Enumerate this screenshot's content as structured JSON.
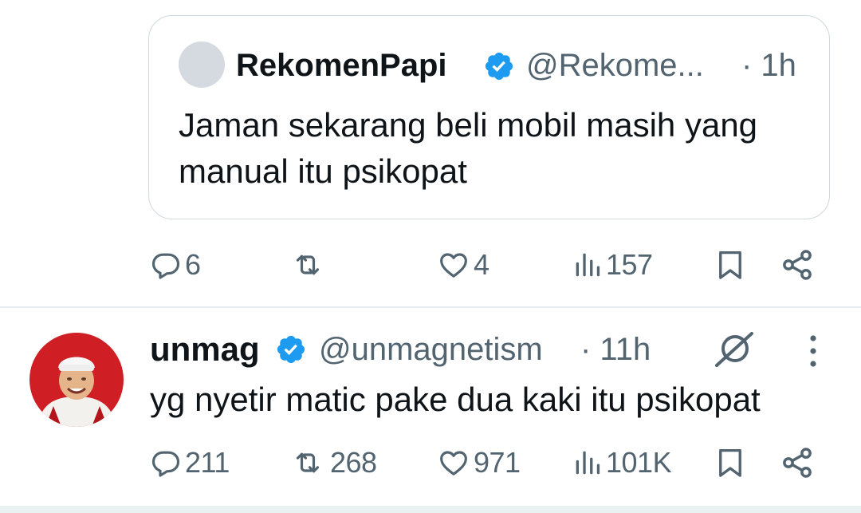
{
  "quote": {
    "name": "RekomenPapi",
    "handle": "@Rekome...",
    "time": "· 1h",
    "text": "Jaman sekarang beli mobil masih yang manual itu psikopat"
  },
  "quote_actions": {
    "replies": "6",
    "likes": "4",
    "views": "157"
  },
  "reply": {
    "name": "unmag",
    "handle": "@unmagnetism",
    "time": "· 11h",
    "text": "yg nyetir matic pake dua kaki itu psikopat"
  },
  "reply_actions": {
    "replies": "211",
    "reposts": "268",
    "likes": "971",
    "views": "101K"
  },
  "icons": {
    "verified": "verified-badge-icon",
    "grok": "grok-icon",
    "more": "more-vertical-icon",
    "reply": "reply-icon",
    "repost": "repost-icon",
    "like": "heart-icon",
    "views": "views-icon",
    "bookmark": "bookmark-icon",
    "share": "share-icon"
  },
  "colors": {
    "verified": "#1d9bf0",
    "text": "#0f1419",
    "secondary": "#536471",
    "border": "#cfd9de"
  }
}
